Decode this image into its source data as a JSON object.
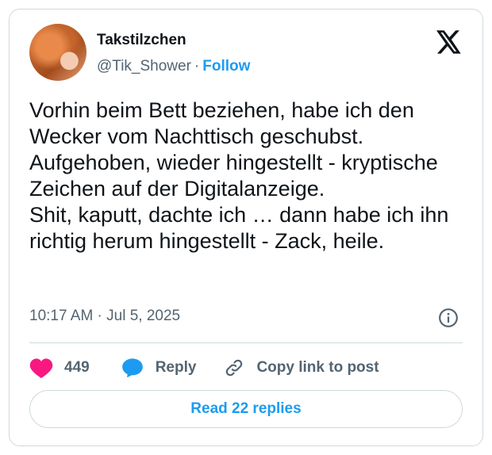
{
  "author": {
    "display_name": "Takstilzchen",
    "handle": "@Tik_Shower",
    "separator": "·",
    "follow_label": "Follow"
  },
  "tweet": {
    "text": "Vorhin beim Bett beziehen, habe ich den Wecker vom Nachttisch geschubst.\nAufgehoben, wieder hingestellt - kryptische Zeichen auf der Digitalanzeige.\nShit, kaputt, dachte ich … dann habe ich ihn richtig herum hingestellt - Zack, heile.",
    "timestamp": "10:17 AM · Jul 5, 2025"
  },
  "actions": {
    "like_count": "449",
    "reply_label": "Reply",
    "copy_link_label": "Copy link to post"
  },
  "footer": {
    "read_replies_label": "Read 22 replies"
  },
  "icons": {
    "brand": "x-logo-icon",
    "info": "info-icon",
    "like": "heart-icon",
    "reply": "speech-bubble-icon",
    "copy": "link-icon"
  },
  "colors": {
    "accent": "#1d9bf0",
    "like": "#f91880",
    "text": "#0f1419",
    "muted": "#536471",
    "border": "#cfd9de"
  }
}
